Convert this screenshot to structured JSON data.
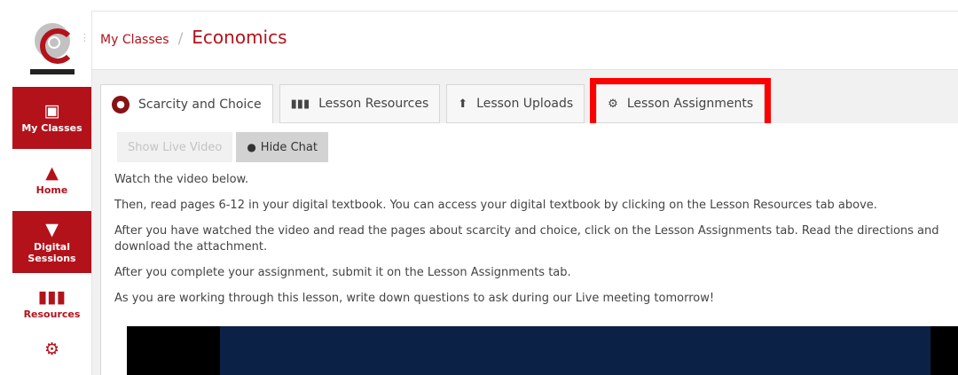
{
  "sidebar": {
    "items": [
      {
        "label": "My Classes",
        "icon": "presentation-board-icon"
      },
      {
        "label": "Home",
        "icon": "home-icon"
      },
      {
        "label": "Digital Sessions",
        "icon": "graduation-cap-icon"
      },
      {
        "label": "Resources",
        "icon": "books-icon"
      },
      {
        "label": "",
        "icon": "brain-gears-icon"
      }
    ]
  },
  "breadcrumb": {
    "parent": "My Classes",
    "separator": "/",
    "current": "Economics"
  },
  "tabs": [
    {
      "label": "Scarcity and Choice",
      "icon": "lesson-icon"
    },
    {
      "label": "Lesson Resources",
      "icon": "books-icon"
    },
    {
      "label": "Lesson Uploads",
      "icon": "upload-icon"
    },
    {
      "label": "Lesson Assignments",
      "icon": "brain-gears-icon"
    }
  ],
  "buttons": {
    "show_video": "Show Live Video",
    "hide_chat": "Hide Chat"
  },
  "content": {
    "p1": "Watch the video below.",
    "p2": "Then, read pages 6-12 in your digital textbook.  You can access your digital textbook by clicking on the Lesson Resources tab above.",
    "p3": "After you have watched the video and read the pages about scarcity and choice, click on the Lesson Assignments tab.  Read the directions and download the attachment.",
    "p4": "After you complete your assignment, submit it on the Lesson Assignments tab.",
    "p5": "As you are working through this lesson, write down questions to ask during our Live meeting tomorrow!"
  },
  "colors": {
    "accent": "#b3121b",
    "highlight": "#ff0000"
  }
}
